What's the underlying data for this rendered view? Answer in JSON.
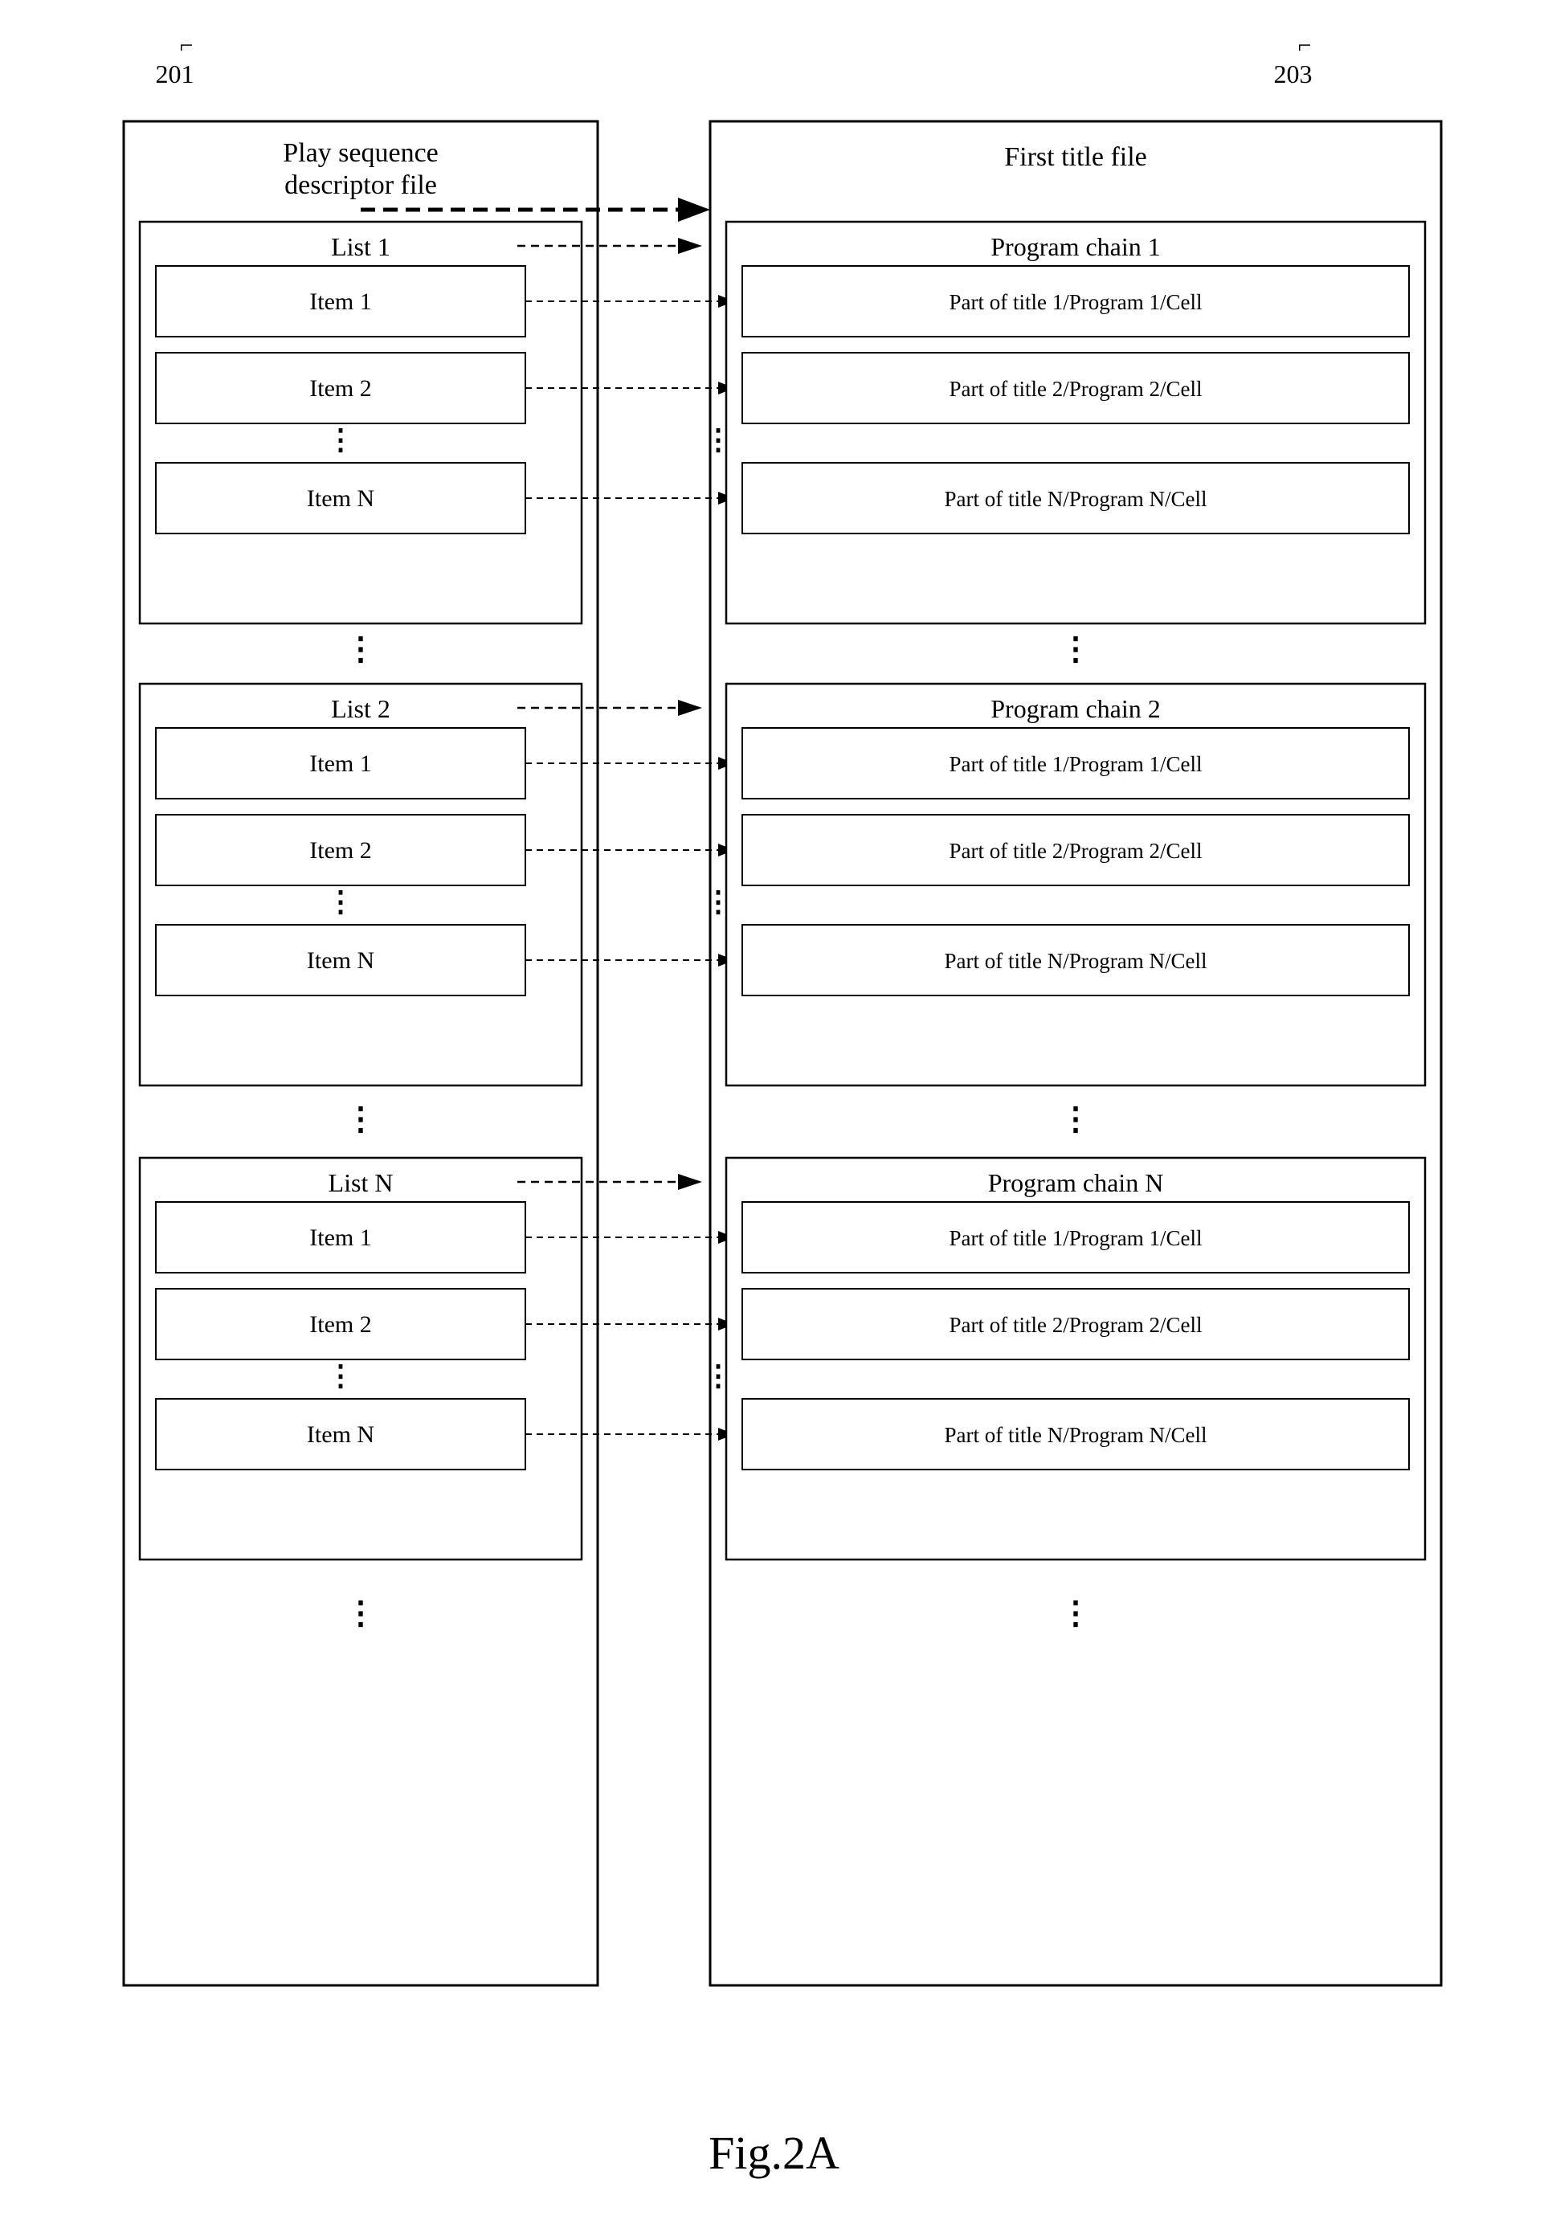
{
  "refs": {
    "left_ref": "201",
    "right_ref": "203"
  },
  "left_box": {
    "title": "Play sequence descriptor file"
  },
  "right_box": {
    "title": "First title file"
  },
  "fig_caption": "Fig.2A",
  "lists": [
    {
      "title": "List 1",
      "items": [
        "Item 1",
        "Item 2",
        "Item N"
      ]
    },
    {
      "title": "List 2",
      "items": [
        "Item 1",
        "Item 2",
        "Item N"
      ]
    },
    {
      "title": "List N",
      "items": [
        "Item 1",
        "Item 2",
        "Item N"
      ]
    }
  ],
  "program_chains": [
    {
      "title": "Program chain 1",
      "items": [
        "Part of title 1/Program 1/Cell",
        "Part of title 2/Program 2/Cell",
        "Part of title N/Program N/Cell"
      ]
    },
    {
      "title": "Program chain 2",
      "items": [
        "Part of title 1/Program 1/Cell",
        "Part of title 2/Program 2/Cell",
        "Part of title N/Program N/Cell"
      ]
    },
    {
      "title": "Program chain N",
      "items": [
        "Part of title 1/Program 1/Cell",
        "Part of title 2/Program 2/Cell",
        "Part of title N/Program N/Cell"
      ]
    }
  ],
  "vertical_dots": "⋮",
  "horizontal_dots_arrow": "- - - - - →"
}
